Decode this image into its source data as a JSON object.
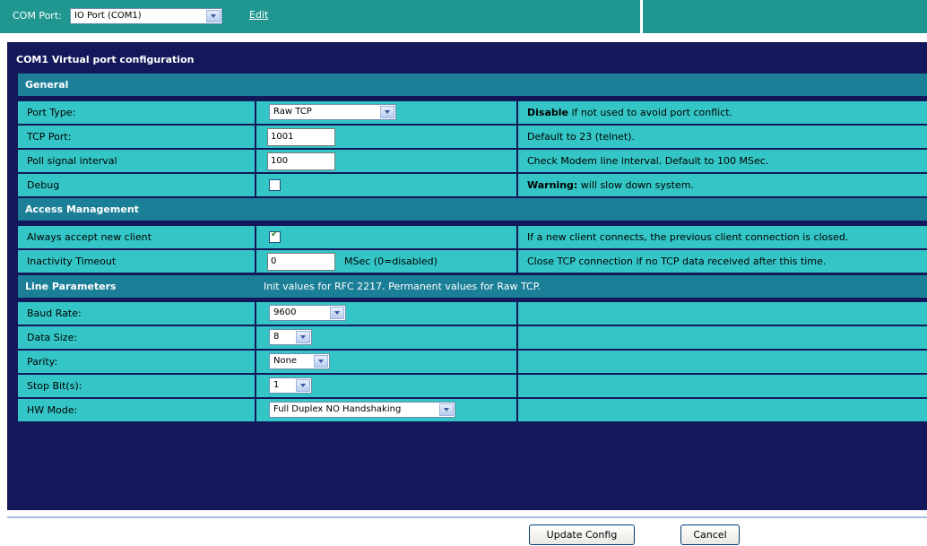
{
  "topbar": {
    "com_port_label": "COM Port:",
    "com_port_value": "IO Port (COM1)",
    "edit_link": "Edit"
  },
  "panel": {
    "title": "COM1 Virtual port configuration",
    "general": {
      "header": "General",
      "port_type": {
        "label": "Port Type:",
        "value": "Raw TCP",
        "note_bold": "Disable",
        "note": " if not used to avoid port conflict."
      },
      "tcp_port": {
        "label": "TCP Port:",
        "value": "1001",
        "note": "Default to 23 (telnet)."
      },
      "poll_interval": {
        "label": "Poll signal interval",
        "value": "100",
        "note": "Check Modem line interval. Default to 100 MSec."
      },
      "debug": {
        "label": "Debug",
        "checked": false,
        "note_bold": "Warning:",
        "note": " will slow down system."
      }
    },
    "access": {
      "header": "Access Management",
      "always_accept": {
        "label": "Always accept new client",
        "checked": true,
        "note": "If a new client connects, the previous client connection is closed."
      },
      "inactivity": {
        "label": "Inactivity Timeout",
        "value": "0",
        "unit": "MSec (0=disabled)",
        "note": "Close TCP connection if no TCP data received after this time."
      }
    },
    "line": {
      "header": "Line Parameters",
      "header_note": "Init values for RFC 2217. Permanent values for Raw TCP.",
      "baud": {
        "label": "Baud Rate:",
        "value": "9600"
      },
      "data_size": {
        "label": "Data Size:",
        "value": "8"
      },
      "parity": {
        "label": "Parity:",
        "value": "None"
      },
      "stop_bits": {
        "label": "Stop Bit(s):",
        "value": "1"
      },
      "hw_mode": {
        "label": "HW Mode:",
        "value": "Full Duplex NO Handshaking"
      }
    }
  },
  "buttons": {
    "update": "Update Config",
    "cancel": "Cancel"
  }
}
